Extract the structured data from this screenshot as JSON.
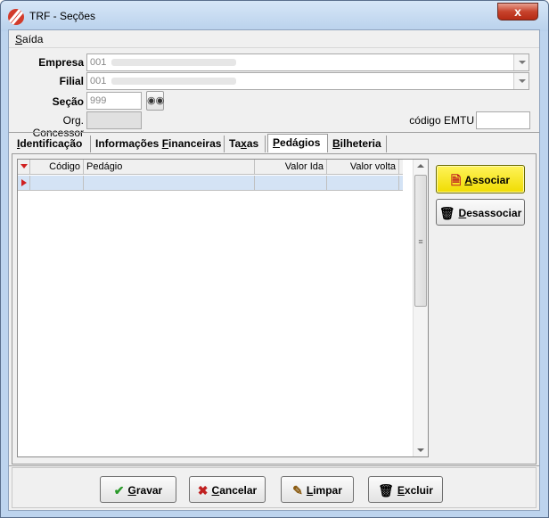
{
  "window": {
    "title": "TRF - Seções",
    "close_glyph": "x",
    "accent_color": "#bdd4ee"
  },
  "menu": {
    "items": [
      {
        "label": "Saída",
        "accel": "S",
        "rest": "aída"
      }
    ]
  },
  "form": {
    "empresa": {
      "label": "Empresa",
      "value": "001"
    },
    "filial": {
      "label": "Filial",
      "value": "001"
    },
    "secao": {
      "label": "Seção",
      "value": "999"
    },
    "org_concessor": {
      "label": "Org. Concessor",
      "value": ""
    },
    "codigo_emtu": {
      "label": "código EMTU",
      "value": ""
    }
  },
  "tabs": [
    {
      "label": "Identificação",
      "accel": "I",
      "rest": "dentificação"
    },
    {
      "label": "Informações Financeiras",
      "pre": "Informações ",
      "accel": "F",
      "rest": "inanceiras"
    },
    {
      "label": "Taxas",
      "pre": "Ta",
      "accel": "x",
      "rest": "as"
    },
    {
      "label": "Pedágios",
      "pre": "",
      "accel": "P",
      "rest": "edágios",
      "active": true
    },
    {
      "label": "Bilheteria",
      "pre": "",
      "accel": "B",
      "rest": "ilheteria"
    }
  ],
  "grid": {
    "columns": [
      "Código",
      "Pedágio",
      "Valor Ida",
      "Valor volta"
    ],
    "rows": [
      [
        "",
        "",
        "",
        ""
      ]
    ]
  },
  "side_buttons": {
    "associar": {
      "label": "Associar",
      "accel": "A",
      "rest": "ssociar",
      "icon": "add-document-icon"
    },
    "desassociar": {
      "label": "Desassociar",
      "accel": "D",
      "rest": "esassociar",
      "icon": "trash-icon"
    }
  },
  "footer_buttons": {
    "gravar": {
      "label": "Gravar",
      "accel": "G",
      "rest": "ravar",
      "icon": "check-icon",
      "color": "#2a9a2a"
    },
    "cancelar": {
      "label": "Cancelar",
      "accel": "C",
      "rest": "ancelar",
      "icon": "x-icon",
      "color": "#c02020"
    },
    "limpar": {
      "label": "Limpar",
      "accel": "L",
      "rest": "impar",
      "icon": "brush-icon"
    },
    "excluir": {
      "label": "Excluir",
      "accel": "E",
      "rest": "xcluir",
      "icon": "trash-icon"
    }
  }
}
